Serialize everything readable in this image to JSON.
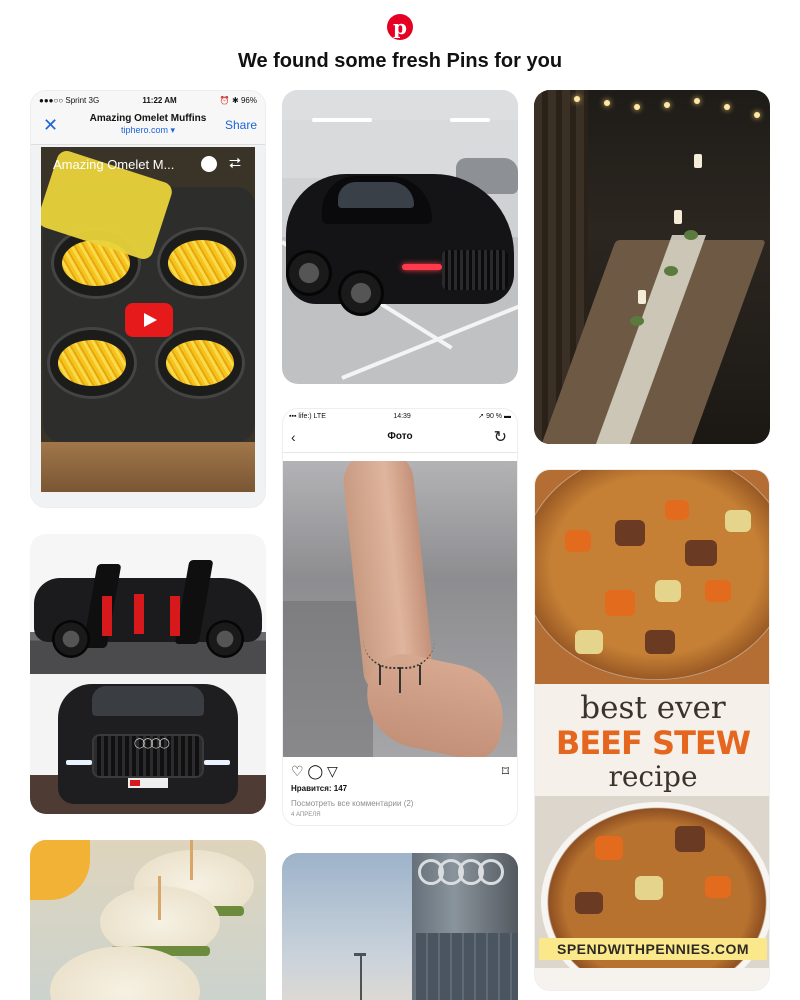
{
  "header": {
    "logo_letter": "p",
    "logo_icon": "pinterest-logo-icon",
    "brand_color": "#e60023",
    "title": "We found some fresh Pins for you"
  },
  "pins": {
    "omelet": {
      "status": {
        "carrier": "●●●○○ Sprint  3G",
        "time": "11:22 AM",
        "battery": "⏰ ✱ 96%"
      },
      "nav": {
        "close": "✕",
        "title": "Amazing Omelet Muffins",
        "source": "tiphero.com ▾",
        "share": "Share"
      },
      "video_title": "Amazing Omelet M...",
      "icons": [
        "clock-icon",
        "share-icon",
        "youtube-play-icon"
      ]
    },
    "mercedes": {
      "alt": "black sports car in parking garage"
    },
    "table": {
      "alt": "rustic wooden dining table with candles"
    },
    "audi_suv": {
      "alt": "black Audi SUV with red interior"
    },
    "tattoo": {
      "status": {
        "carrier": "▪▪▪ life:)  LTE",
        "time": "14:39",
        "battery": "➚ 90 % ▬"
      },
      "nav": {
        "back": "‹",
        "title": "Фото",
        "refresh": "↻"
      },
      "actions": {
        "like": "♡",
        "comment": "◯",
        "send": "▽",
        "save": "⌑"
      },
      "likes": "Нравится: 147",
      "comments": "Посмотреть все комментарии (2)",
      "date": "4 АПРЕЛЯ"
    },
    "stew": {
      "line1": "best ever",
      "line2": "BEEF STEW",
      "line3": "recipe",
      "site": "SPENDWITHPENNIES.COM",
      "accent_color": "#e4661f"
    },
    "sliders": {
      "alt": "egg slider appetizers"
    },
    "building": {
      "alt": "Audi building facade"
    }
  }
}
